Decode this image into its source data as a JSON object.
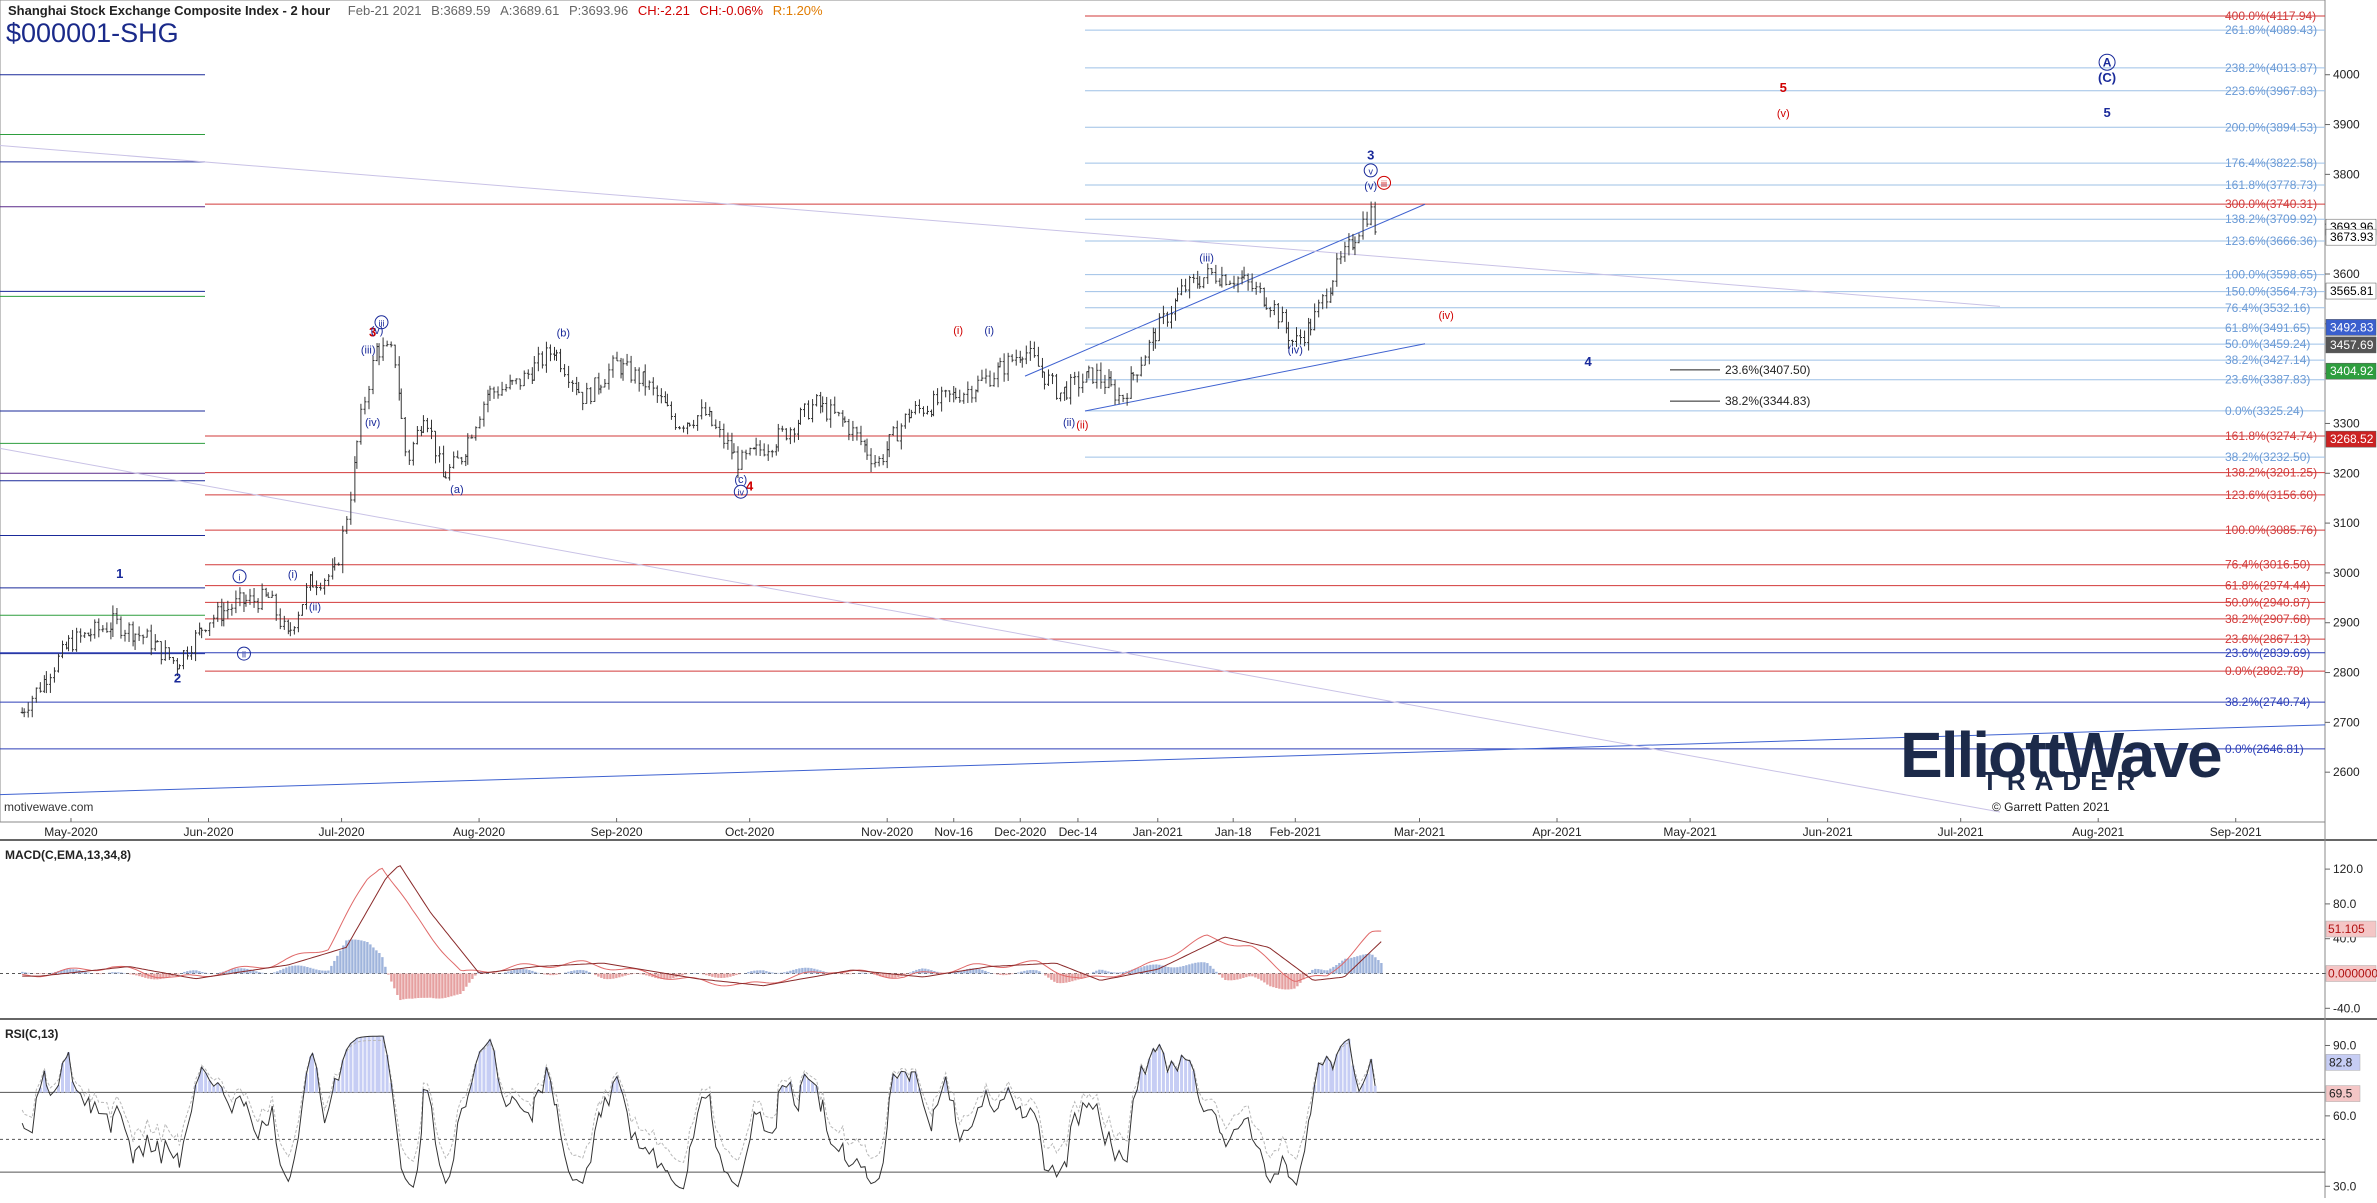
{
  "header": {
    "title": "Shanghai Stock Exchange Composite Index - 2 hour",
    "date": "Feb-21 2021",
    "bid": "B:3689.59",
    "ask": "A:3689.61",
    "price": "P:3693.96",
    "change": "CH:-2.21",
    "change_pct": "CH:-0.06%",
    "range": "R:1.20%"
  },
  "symbol": "$000001-SHG",
  "watermark": "motivewave.com",
  "logo": {
    "line1": "ElliottWave",
    "line2": "TRADER",
    "copyright": "© Garrett Patten 2021"
  },
  "chart_data": [
    {
      "type": "candlestick",
      "pane": "price",
      "ylim": [
        2500,
        4150
      ],
      "y_ticks": [
        2600,
        2700,
        2800,
        2900,
        3000,
        3100,
        3200,
        3300,
        3400,
        3500,
        3600,
        3700,
        3800,
        3900,
        4000
      ],
      "x_tick_labels": [
        "May-2020",
        "Jun-2020",
        "Jul-2020",
        "Aug-2020",
        "Sep-2020",
        "Oct-2020",
        "Nov-2020",
        "Nov-16",
        "Dec-2020",
        "Dec-14",
        "Jan-2021",
        "Jan-18",
        "Feb-2021",
        "Mar-2021",
        "Apr-2021",
        "May-2021",
        "Jun-2021",
        "Jul-2021",
        "Aug-2021",
        "Sep-2021"
      ],
      "price_path": [
        [
          "2020-04-20",
          2720
        ],
        [
          "2020-05-01",
          2860
        ],
        [
          "2020-05-11",
          2900
        ],
        [
          "2020-05-18",
          2870
        ],
        [
          "2020-05-25",
          2818
        ],
        [
          "2020-06-01",
          2905
        ],
        [
          "2020-06-08",
          2940
        ],
        [
          "2020-06-15",
          2950
        ],
        [
          "2020-06-19",
          2870
        ],
        [
          "2020-06-24",
          2980
        ],
        [
          "2020-06-30",
          3000
        ],
        [
          "2020-07-03",
          3150
        ],
        [
          "2020-07-06",
          3330
        ],
        [
          "2020-07-09",
          3450
        ],
        [
          "2020-07-13",
          3440
        ],
        [
          "2020-07-16",
          3220
        ],
        [
          "2020-07-20",
          3330
        ],
        [
          "2020-07-24",
          3190
        ],
        [
          "2020-07-28",
          3230
        ],
        [
          "2020-08-03",
          3360
        ],
        [
          "2020-08-10",
          3380
        ],
        [
          "2020-08-18",
          3450
        ],
        [
          "2020-08-25",
          3350
        ],
        [
          "2020-09-01",
          3420
        ],
        [
          "2020-09-08",
          3380
        ],
        [
          "2020-09-15",
          3300
        ],
        [
          "2020-09-21",
          3320
        ],
        [
          "2020-09-29",
          3220
        ],
        [
          "2020-10-09",
          3280
        ],
        [
          "2020-10-16",
          3340
        ],
        [
          "2020-10-23",
          3300
        ],
        [
          "2020-10-30",
          3220
        ],
        [
          "2020-11-06",
          3320
        ],
        [
          "2020-11-12",
          3340
        ],
        [
          "2020-11-20",
          3370
        ],
        [
          "2020-11-27",
          3410
        ],
        [
          "2020-12-02",
          3450
        ],
        [
          "2020-12-10",
          3360
        ],
        [
          "2020-12-18",
          3400
        ],
        [
          "2020-12-24",
          3350
        ],
        [
          "2020-12-31",
          3470
        ],
        [
          "2021-01-07",
          3570
        ],
        [
          "2021-01-13",
          3600
        ],
        [
          "2021-01-20",
          3590
        ],
        [
          "2021-01-27",
          3540
        ],
        [
          "2021-02-01",
          3460
        ],
        [
          "2021-02-05",
          3500
        ],
        [
          "2021-02-10",
          3600
        ],
        [
          "2021-02-18",
          3730
        ],
        [
          "2021-02-19",
          3694
        ]
      ],
      "fib_levels_red": [
        {
          "label": "0.0%(2802.78)",
          "value": 2802.78
        },
        {
          "label": "23.6%(2867.13)",
          "value": 2867.13
        },
        {
          "label": "38.2%(2907.68)",
          "value": 2907.68
        },
        {
          "label": "50.0%(2940.87)",
          "value": 2940.87
        },
        {
          "label": "61.8%(2974.44)",
          "value": 2974.44
        },
        {
          "label": "76.4%(3016.50)",
          "value": 3016.5
        },
        {
          "label": "100.0%(3085.76)",
          "value": 3085.76
        },
        {
          "label": "123.6%(3156.60)",
          "value": 3156.6
        },
        {
          "label": "138.2%(3201.25)",
          "value": 3201.25
        },
        {
          "label": "161.8%(3274.74)",
          "value": 3274.74
        },
        {
          "label": "300.0%(3740.31)",
          "value": 3740.31
        },
        {
          "label": "400.0%(4117.94)",
          "value": 4117.94
        }
      ],
      "fib_levels_blue": [
        {
          "label": "23.6%(2839.69)",
          "value": 2839.69
        },
        {
          "label": "38.2%(2740.74)",
          "value": 2740.74
        },
        {
          "label": "0.0%(2646.81)",
          "value": 2646.81
        },
        {
          "label": "23.6%(3387.83)",
          "value": 3387.83
        },
        {
          "label": "38.2%(3427.14)",
          "value": 3427.14
        },
        {
          "label": "50.0%(3459.24)",
          "value": 3459.24
        },
        {
          "label": "61.8%(3491.65)",
          "value": 3491.65
        },
        {
          "label": "76.4%(3532.16)",
          "value": 3532.16
        },
        {
          "label": "100.0%(3598.65)",
          "value": 3598.65
        },
        {
          "label": "123.6%(3666.36)",
          "value": 3666.36
        },
        {
          "label": "138.2%(3709.92)",
          "value": 3709.92
        },
        {
          "label": "161.8%(3778.73)",
          "value": 3778.73
        },
        {
          "label": "176.4%(3822.58)",
          "value": 3822.58
        },
        {
          "label": "200.0%(3894.53)",
          "value": 3894.53
        },
        {
          "label": "223.6%(3967.83)",
          "value": 3967.83
        },
        {
          "label": "238.2%(4013.87)",
          "value": 4013.87
        },
        {
          "label": "261.8%(4089.43)",
          "value": 4089.43
        },
        {
          "label": "150.0%(3564.73)",
          "value": 3564.73
        },
        {
          "label": "38.2%(3232.50)",
          "value": 3232.5
        },
        {
          "label": "0.0%(3325.24)",
          "value": 3325.24
        }
      ],
      "fib_levels_black": [
        {
          "label": "23.6%(3407.50)",
          "value": 3407.5
        },
        {
          "label": "38.2%(3344.83)",
          "value": 3344.83
        }
      ],
      "price_badges": [
        {
          "label": "3693.96",
          "value": 3693.96,
          "color": "#ffffff",
          "text": "#000000"
        },
        {
          "label": "3673.93",
          "value": 3673.93,
          "color": "#ffffff",
          "text": "#000000"
        },
        {
          "label": "3565.81",
          "value": 3565.81,
          "color": "#ffffff",
          "text": "#000000"
        },
        {
          "label": "3492.83",
          "value": 3492.83,
          "color": "#3a5fcd",
          "text": "#ffffff"
        },
        {
          "label": "3457.69",
          "value": 3457.69,
          "color": "#555555",
          "text": "#ffffff"
        },
        {
          "label": "3404.92",
          "value": 3404.92,
          "color": "#2e9e3e",
          "text": "#ffffff"
        },
        {
          "label": "3268.52",
          "value": 3268.52,
          "color": "#cc2222",
          "text": "#ffffff"
        }
      ],
      "wave_labels": [
        {
          "text": "1",
          "date": "2020-05-12",
          "value": 2990,
          "color": "#1a2a9a"
        },
        {
          "text": "2",
          "date": "2020-05-25",
          "value": 2780,
          "color": "#1a2a9a"
        },
        {
          "text": "3",
          "date": "2020-07-08",
          "value": 3475,
          "color": "#d00000"
        },
        {
          "text": "4",
          "date": "2020-10-01",
          "value": 3165,
          "color": "#d00000"
        },
        {
          "text": "3",
          "date": "2021-02-18",
          "value": 3830,
          "color": "#1a2a9a"
        },
        {
          "text": "4",
          "date": "2021-04-08",
          "value": 3415,
          "color": "#1a2a9a"
        },
        {
          "text": "5",
          "date": "2021-05-22",
          "value": 3965,
          "color": "#d00000"
        },
        {
          "text": "5",
          "date": "2021-08-03",
          "value": 3915,
          "color": "#1a2a9a"
        },
        {
          "text": "(C)",
          "date": "2021-08-03",
          "value": 3985,
          "color": "#1a2a9a"
        },
        {
          "text": "(a)",
          "date": "2020-07-27",
          "value": 3160,
          "color": "#1a2a9a"
        },
        {
          "text": "(b)",
          "date": "2020-08-20",
          "value": 3475,
          "color": "#1a2a9a"
        },
        {
          "text": "(c)",
          "date": "2020-09-29",
          "value": 3180,
          "color": "#1a2a9a"
        },
        {
          "text": "(i)",
          "date": "2020-06-20",
          "value": 2990,
          "color": "#1a2a9a"
        },
        {
          "text": "(ii)",
          "date": "2020-06-25",
          "value": 2925,
          "color": "#1a2a9a"
        },
        {
          "text": "(iii)",
          "date": "2020-07-07",
          "value": 3440,
          "color": "#1a2a9a"
        },
        {
          "text": "(iv)",
          "date": "2020-07-08",
          "value": 3295,
          "color": "#1a2a9a"
        },
        {
          "text": "(v)",
          "date": "2020-07-09",
          "value": 3480,
          "color": "#1a2a9a"
        },
        {
          "text": "(i)",
          "date": "2020-11-24",
          "value": 3480,
          "color": "#1a2a9a"
        },
        {
          "text": "(ii)",
          "date": "2020-12-12",
          "value": 3295,
          "color": "#1a2a9a"
        },
        {
          "text": "(iii)",
          "date": "2021-01-12",
          "value": 3625,
          "color": "#1a2a9a"
        },
        {
          "text": "(iv)",
          "date": "2021-02-01",
          "value": 3440,
          "color": "#1a2a9a"
        },
        {
          "text": "(v)",
          "date": "2021-02-18",
          "value": 3770,
          "color": "#1a2a9a"
        },
        {
          "text": "(i)",
          "date": "2020-11-17",
          "value": 3480,
          "color": "#d00000"
        },
        {
          "text": "(ii)",
          "date": "2020-12-15",
          "value": 3290,
          "color": "#d00000"
        },
        {
          "text": "(iv)",
          "date": "2021-03-07",
          "value": 3510,
          "color": "#d00000"
        },
        {
          "text": "(v)",
          "date": "2021-05-22",
          "value": 3915,
          "color": "#d00000"
        }
      ],
      "circled_labels": [
        {
          "text": "i",
          "date": "2020-06-08",
          "value": 2985,
          "color": "#1a2a9a"
        },
        {
          "text": "ii",
          "date": "2020-06-09",
          "value": 2830,
          "color": "#1a2a9a"
        },
        {
          "text": "iii",
          "date": "2020-07-10",
          "value": 3495,
          "color": "#1a2a9a"
        },
        {
          "text": "iv",
          "date": "2020-09-29",
          "value": 3155,
          "color": "#1a2a9a"
        },
        {
          "text": "v",
          "date": "2021-02-18",
          "value": 3800,
          "color": "#1a2a9a"
        },
        {
          "text": "iii",
          "date": "2021-02-21",
          "value": 3775,
          "color": "#d00000"
        },
        {
          "text": "A",
          "date": "2021-08-03",
          "value": 4017,
          "color": "#1a2a9a"
        }
      ]
    },
    {
      "type": "line",
      "pane": "macd",
      "title": "MACD(C,EMA,13,34,8)",
      "ylim": [
        -50,
        150
      ],
      "y_ticks": [
        -40.0,
        0.0,
        40.0,
        80.0,
        120.0
      ],
      "macd_path": [
        [
          "2020-04-20",
          -3
        ],
        [
          "2020-05-10",
          8
        ],
        [
          "2020-05-25",
          -6
        ],
        [
          "2020-06-15",
          10
        ],
        [
          "2020-06-28",
          30
        ],
        [
          "2020-07-07",
          110
        ],
        [
          "2020-07-10",
          125
        ],
        [
          "2020-07-17",
          70
        ],
        [
          "2020-07-28",
          0
        ],
        [
          "2020-08-10",
          8
        ],
        [
          "2020-08-25",
          12
        ],
        [
          "2020-09-15",
          -6
        ],
        [
          "2020-09-30",
          -14
        ],
        [
          "2020-10-20",
          4
        ],
        [
          "2020-11-05",
          -4
        ],
        [
          "2020-11-20",
          8
        ],
        [
          "2020-12-05",
          12
        ],
        [
          "2020-12-15",
          -8
        ],
        [
          "2020-12-28",
          5
        ],
        [
          "2021-01-12",
          42
        ],
        [
          "2021-01-22",
          30
        ],
        [
          "2021-02-01",
          -8
        ],
        [
          "2021-02-08",
          -4
        ],
        [
          "2021-02-18",
          45
        ],
        [
          "2021-02-21",
          48
        ]
      ],
      "badges": [
        {
          "label": "51.105",
          "value": 51.105,
          "color": "#f4c6c6"
        },
        {
          "label": "0.000000",
          "value": 0,
          "color": "#f4c6c6"
        }
      ]
    },
    {
      "type": "line",
      "pane": "rsi",
      "title": "RSI(C,13)",
      "ylim": [
        25,
        100
      ],
      "y_ticks": [
        30.0,
        60.0,
        90.0
      ],
      "reference_levels": [
        70,
        50
      ],
      "badges": [
        {
          "label": "82.8",
          "value": 82.8,
          "color": "#c6cdf4"
        },
        {
          "label": "69.5",
          "value": 69.5,
          "color": "#f4c6c6"
        }
      ]
    }
  ]
}
